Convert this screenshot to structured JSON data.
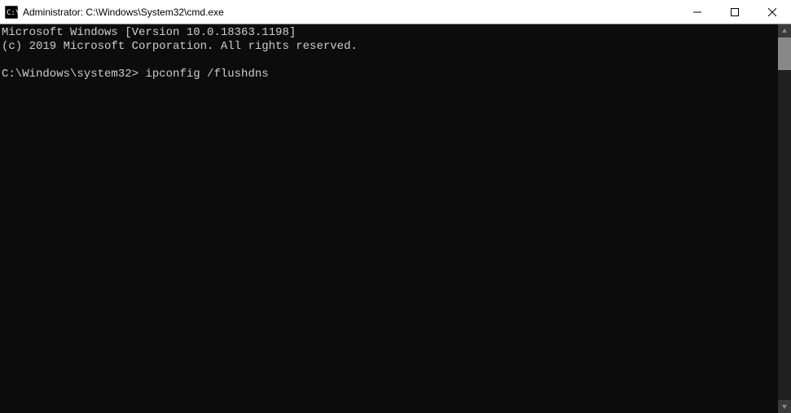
{
  "titlebar": {
    "title": "Administrator: C:\\Windows\\System32\\cmd.exe",
    "icon_name": "cmd-icon"
  },
  "window_controls": {
    "minimize": "minimize",
    "maximize": "maximize",
    "close": "close"
  },
  "terminal": {
    "line1": "Microsoft Windows [Version 10.0.18363.1198]",
    "line2": "(c) 2019 Microsoft Corporation. All rights reserved.",
    "blank": "",
    "prompt": "C:\\Windows\\system32>",
    "command": "ipconfig /flushdns"
  }
}
